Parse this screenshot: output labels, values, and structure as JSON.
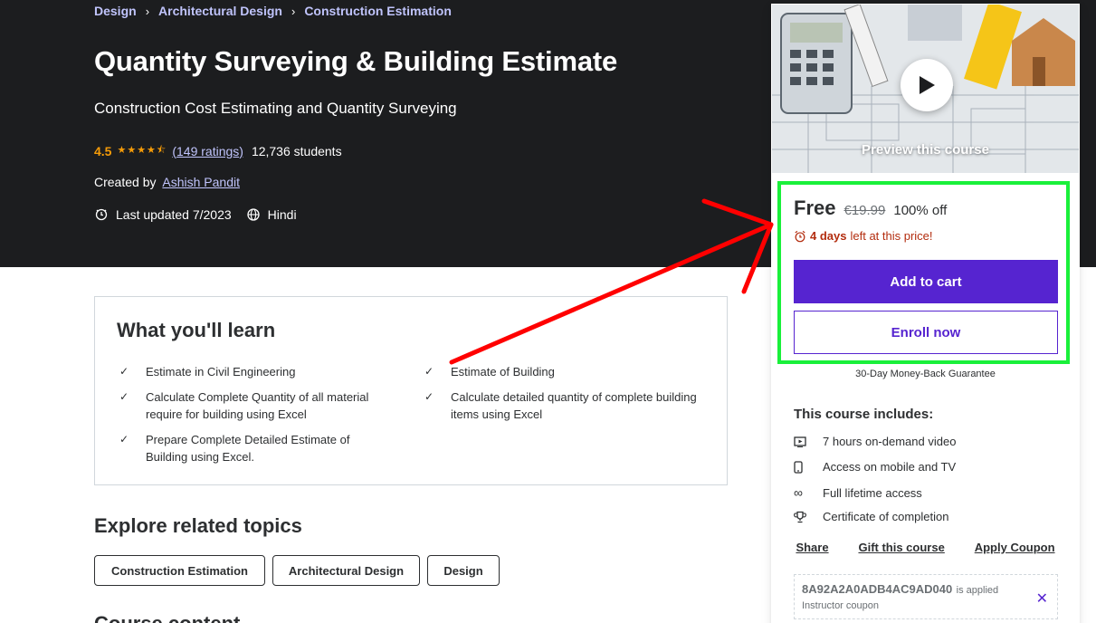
{
  "breadcrumb": [
    "Design",
    "Architectural Design",
    "Construction Estimation"
  ],
  "course": {
    "title": "Quantity Surveying & Building Estimate",
    "subtitle": "Construction Cost Estimating and Quantity Surveying",
    "rating": "4.5",
    "ratings_count": "(149 ratings)",
    "students": "12,736 students",
    "created_by_label": "Created by",
    "author": "Ashish Pandit",
    "last_updated": "Last updated 7/2023",
    "language": "Hindi"
  },
  "learn": {
    "heading": "What you'll learn",
    "items": [
      "Estimate in Civil Engineering",
      "Estimate of Building",
      "Calculate Complete Quantity of all material require for building using Excel",
      "Calculate detailed quantity of complete building items using Excel",
      "Prepare Complete Detailed Estimate of Building using Excel."
    ]
  },
  "explore": {
    "heading": "Explore related topics",
    "topics": [
      "Construction Estimation",
      "Architectural Design",
      "Design"
    ]
  },
  "course_content_heading": "Course content",
  "sidebar": {
    "preview_label": "Preview this course",
    "price": "Free",
    "original_price": "€19.99",
    "discount": "100% off",
    "timer_days": "4 days",
    "timer_rest": "left at this price!",
    "add_to_cart": "Add to cart",
    "enroll_now": "Enroll now",
    "guarantee": "30-Day Money-Back Guarantee",
    "includes_heading": "This course includes:",
    "includes": [
      {
        "icon": "video-icon",
        "text": "7 hours on-demand video"
      },
      {
        "icon": "mobile-icon",
        "text": "Access on mobile and TV"
      },
      {
        "icon": "infinity-icon",
        "text": "Full lifetime access"
      },
      {
        "icon": "trophy-icon",
        "text": "Certificate of completion"
      }
    ],
    "links": [
      "Share",
      "Gift this course",
      "Apply Coupon"
    ],
    "coupon_code": "8A92A2A0ADB4AC9AD040",
    "coupon_applied": "is applied",
    "coupon_type": "Instructor coupon"
  },
  "colors": {
    "hero_bg": "#1c1d1f",
    "accent_purple": "#5624d0",
    "star_orange": "#f69c08",
    "link_lavender": "#c0c4fc",
    "timer_red": "#b32d0f",
    "annotation_green": "#19f03a",
    "annotation_red": "#ff0000"
  }
}
